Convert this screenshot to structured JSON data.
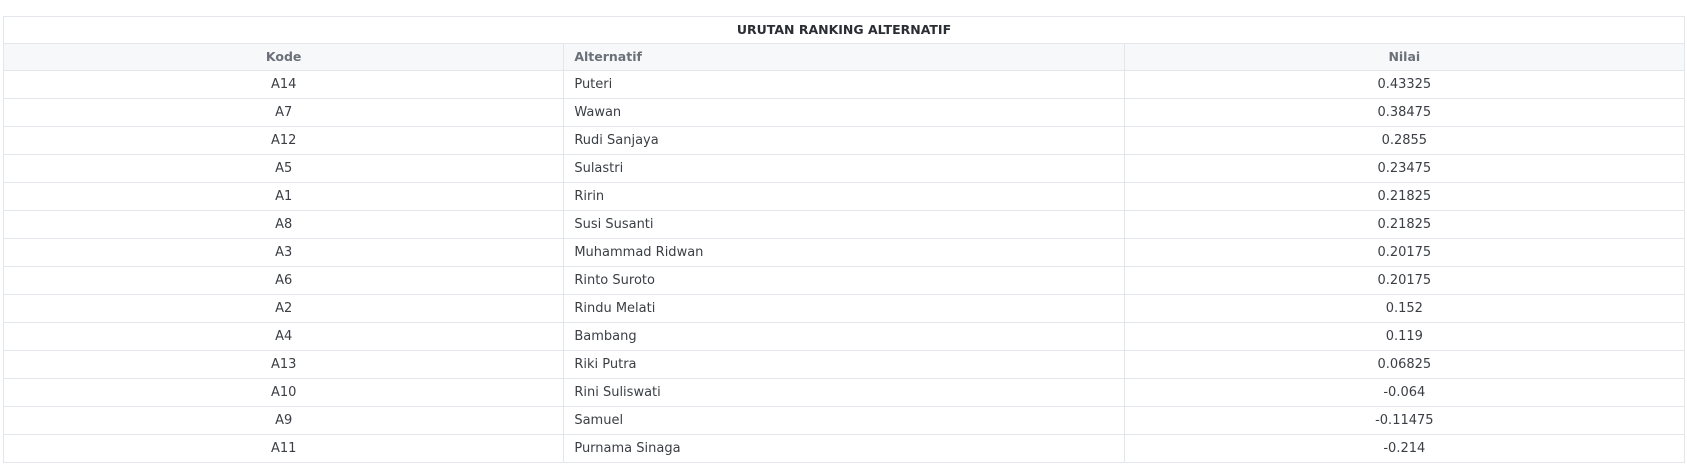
{
  "table": {
    "caption": "URUTAN RANKING ALTERNATIF",
    "headers": {
      "kode": "Kode",
      "alternatif": "Alternatif",
      "nilai": "Nilai"
    },
    "rows": [
      {
        "kode": "A14",
        "alternatif": "Puteri",
        "nilai": "0.43325"
      },
      {
        "kode": "A7",
        "alternatif": "Wawan",
        "nilai": "0.38475"
      },
      {
        "kode": "A12",
        "alternatif": "Rudi Sanjaya",
        "nilai": "0.2855"
      },
      {
        "kode": "A5",
        "alternatif": "Sulastri",
        "nilai": "0.23475"
      },
      {
        "kode": "A1",
        "alternatif": "Ririn",
        "nilai": "0.21825"
      },
      {
        "kode": "A8",
        "alternatif": "Susi Susanti",
        "nilai": "0.21825"
      },
      {
        "kode": "A3",
        "alternatif": "Muhammad Ridwan",
        "nilai": "0.20175"
      },
      {
        "kode": "A6",
        "alternatif": "Rinto Suroto",
        "nilai": "0.20175"
      },
      {
        "kode": "A2",
        "alternatif": "Rindu Melati",
        "nilai": "0.152"
      },
      {
        "kode": "A4",
        "alternatif": "Bambang",
        "nilai": "0.119"
      },
      {
        "kode": "A13",
        "alternatif": "Riki Putra",
        "nilai": "0.06825"
      },
      {
        "kode": "A10",
        "alternatif": "Rini Suliswati",
        "nilai": "-0.064"
      },
      {
        "kode": "A9",
        "alternatif": "Samuel",
        "nilai": "-0.11475"
      },
      {
        "kode": "A11",
        "alternatif": "Purnama Sinaga",
        "nilai": "-0.214"
      }
    ]
  }
}
